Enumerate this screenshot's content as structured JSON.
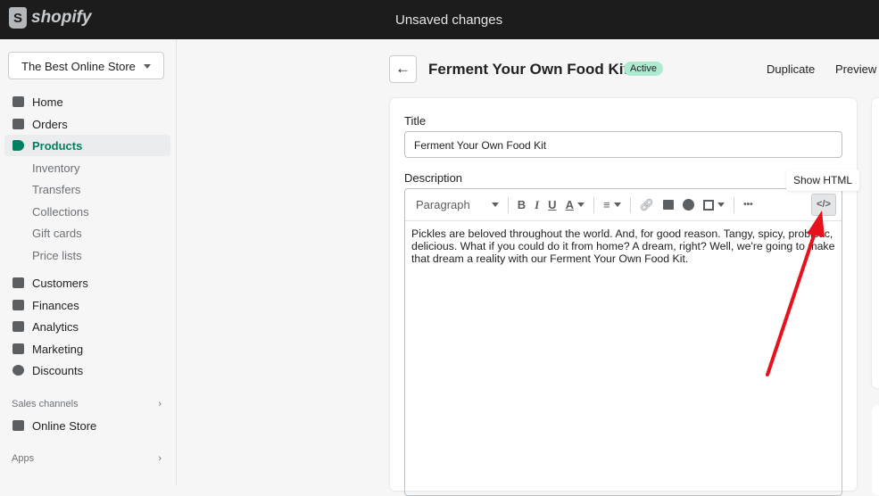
{
  "topbar": {
    "brand": "shopify",
    "status": "Unsaved changes"
  },
  "sidebar": {
    "store": "The Best Online Store",
    "items": [
      {
        "label": "Home"
      },
      {
        "label": "Orders"
      },
      {
        "label": "Products"
      },
      {
        "label": "Inventory"
      },
      {
        "label": "Transfers"
      },
      {
        "label": "Collections"
      },
      {
        "label": "Gift cards"
      },
      {
        "label": "Price lists"
      },
      {
        "label": "Customers"
      },
      {
        "label": "Finances"
      },
      {
        "label": "Analytics"
      },
      {
        "label": "Marketing"
      },
      {
        "label": "Discounts"
      }
    ],
    "sales_channels": "Sales channels",
    "online_store": "Online Store",
    "apps": "Apps"
  },
  "header": {
    "title": "Ferment Your Own Food Kit",
    "badge": "Active",
    "duplicate": "Duplicate",
    "preview": "Preview"
  },
  "form": {
    "title_label": "Title",
    "title_value": "Ferment Your Own Food Kit",
    "description_label": "Description",
    "toolbar": {
      "format": "Paragraph",
      "bold": "B",
      "italic": "I",
      "underline": "U",
      "color": "A",
      "more": "•••",
      "html": "</>"
    },
    "description": "Pickles are beloved throughout the world. And, for good reason. Tangy, spicy, probiotic, delicious. What if you could do it from home? A dream, right? Well, we're going to make that dream a reality with our Ferment Your Own Food Kit."
  },
  "tooltip": "Show HTML",
  "colors": {
    "accent": "#008060",
    "annotation": "#e8101a"
  }
}
